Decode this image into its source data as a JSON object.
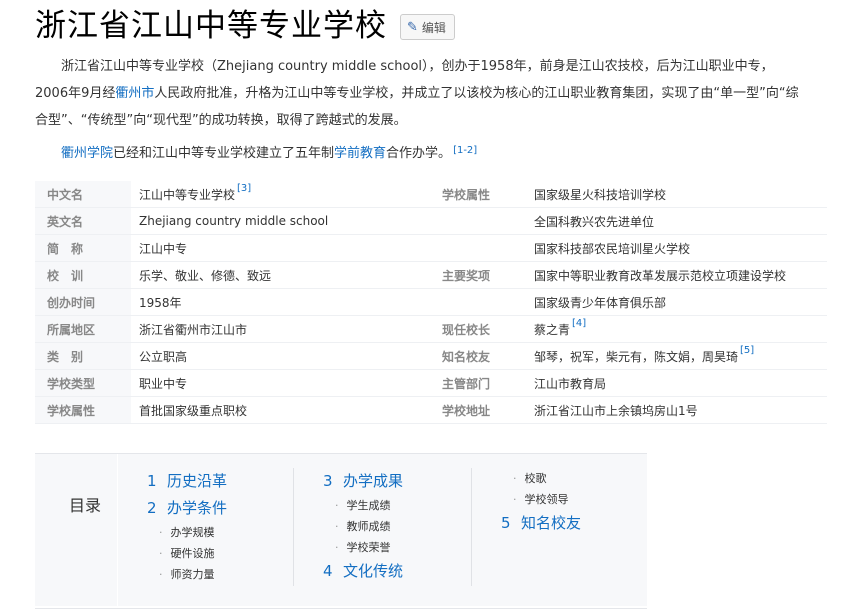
{
  "header": {
    "title": "浙江省江山中等专业学校",
    "edit_label": "编辑"
  },
  "intro": {
    "p1_a": "浙江省江山中等专业学校（Zhejiang country middle school），创办于1958年，前身是江山农技校，后为江山职业中专，2006年9月经",
    "p1_link": "衢州市",
    "p1_b": "人民政府批准，升格为江山中等专业学校，并成立了以该校为核心的江山职业教育集团，实现了由“单一型”向“综合型”、“传统型”向“现代型”的成功转换，取得了跨越式的发展。",
    "p2_link1": "衢州学院",
    "p2_a": "已经和江山中等专业学校建立了五年制",
    "p2_link2": "学前教育",
    "p2_b": "合作办学。",
    "p2_ref": "[1-2]"
  },
  "info_rows": [
    {
      "l1": "中文名",
      "v1": "江山中等专业学校",
      "r1": "[3]",
      "l2": "学校属性",
      "v2": "国家级星火科技培训学校",
      "r2": ""
    },
    {
      "l1": "英文名",
      "v1": "Zhejiang country middle school",
      "r1": "",
      "l2": "",
      "v2": "全国科教兴农先进单位",
      "r2": ""
    },
    {
      "l1": "简　称",
      "v1": "江山中专",
      "r1": "",
      "l2": "",
      "v2": "国家科技部农民培训星火学校",
      "r2": ""
    },
    {
      "l1": "校　训",
      "v1": "乐学、敬业、修德、致远",
      "r1": "",
      "l2": "主要奖项",
      "v2": "国家中等职业教育改革发展示范校立项建设学校",
      "r2": ""
    },
    {
      "l1": "创办时间",
      "v1": "1958年",
      "r1": "",
      "l2": "",
      "v2": "国家级青少年体育俱乐部",
      "r2": ""
    },
    {
      "l1": "所属地区",
      "v1": "浙江省衢州市江山市",
      "r1": "",
      "l2": "现任校长",
      "v2": "蔡之青",
      "r2": "[4]"
    },
    {
      "l1": "类　别",
      "v1": "公立职高",
      "r1": "",
      "l2": "知名校友",
      "v2": "邹琴，祝军，柴元有，陈文娟，周昊琦",
      "r2": "[5]"
    },
    {
      "l1": "学校类型",
      "v1": "职业中专",
      "r1": "",
      "l2": "主管部门",
      "v2": "江山市教育局",
      "r2": ""
    },
    {
      "l1": "学校属性",
      "v1": "首批国家级重点职校",
      "r1": "",
      "l2": "学校地址",
      "v2": "浙江省江山市上余镇坞房山1号",
      "r2": ""
    }
  ],
  "toc": {
    "title": "目录",
    "col1": {
      "h1": {
        "num": "1",
        "label": "历史沿革"
      },
      "h2": {
        "num": "2",
        "label": "办学条件"
      },
      "subs": [
        "办学规模",
        "硬件设施",
        "师资力量"
      ]
    },
    "col2": {
      "h1": {
        "num": "3",
        "label": "办学成果"
      },
      "subs": [
        "学生成绩",
        "教师成绩",
        "学校荣誉"
      ],
      "h2": {
        "num": "4",
        "label": "文化传统"
      }
    },
    "col3": {
      "subs": [
        "校歌",
        "学校领导"
      ],
      "h1": {
        "num": "5",
        "label": "知名校友"
      }
    }
  }
}
